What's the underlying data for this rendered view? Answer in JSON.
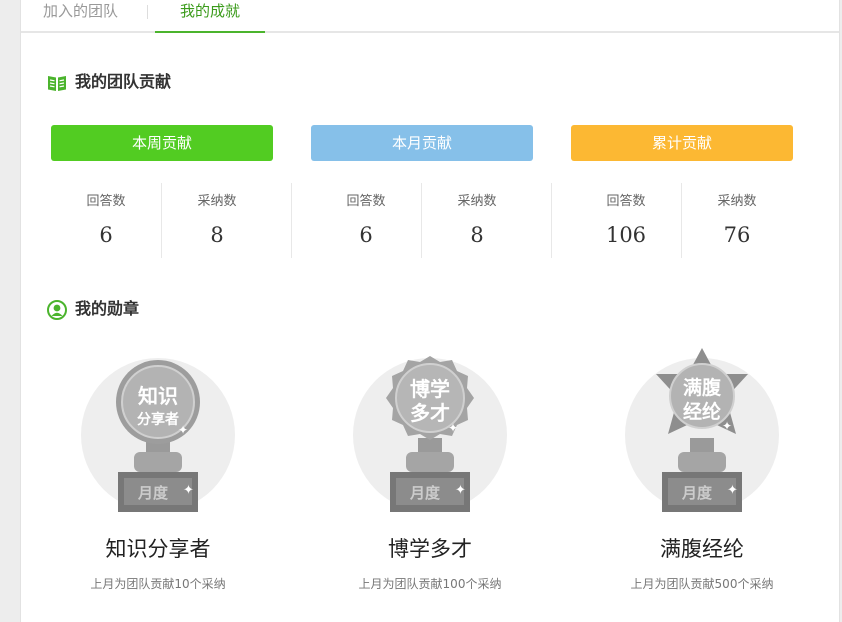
{
  "tabs": {
    "joined_team": "加入的团队",
    "my_achievements": "我的成就"
  },
  "contribution": {
    "title": "我的团队贡献",
    "groups": [
      {
        "label": "本周贡献",
        "color": "#52cc22",
        "answers_label": "回答数",
        "answers": "6",
        "adopted_label": "采纳数",
        "adopted": "8"
      },
      {
        "label": "本月贡献",
        "color": "#86c0e9",
        "answers_label": "回答数",
        "answers": "6",
        "adopted_label": "采纳数",
        "adopted": "8"
      },
      {
        "label": "累计贡献",
        "color": "#fcb833",
        "answers_label": "回答数",
        "answers": "106",
        "adopted_label": "采纳数",
        "adopted": "76"
      }
    ]
  },
  "medals": {
    "title": "我的勋章",
    "items": [
      {
        "emblem_line1": "知识",
        "emblem_line2": "分享者",
        "base_text": "月度",
        "name": "知识分享者",
        "desc": "上月为团队贡献10个采纳"
      },
      {
        "emblem_line1": "博学",
        "emblem_line2": "多才",
        "base_text": "月度",
        "name": "博学多才",
        "desc": "上月为团队贡献100个采纳"
      },
      {
        "emblem_line1": "满腹",
        "emblem_line2": "经纶",
        "base_text": "月度",
        "name": "满腹经纶",
        "desc": "上月为团队贡献500个采纳"
      }
    ]
  }
}
